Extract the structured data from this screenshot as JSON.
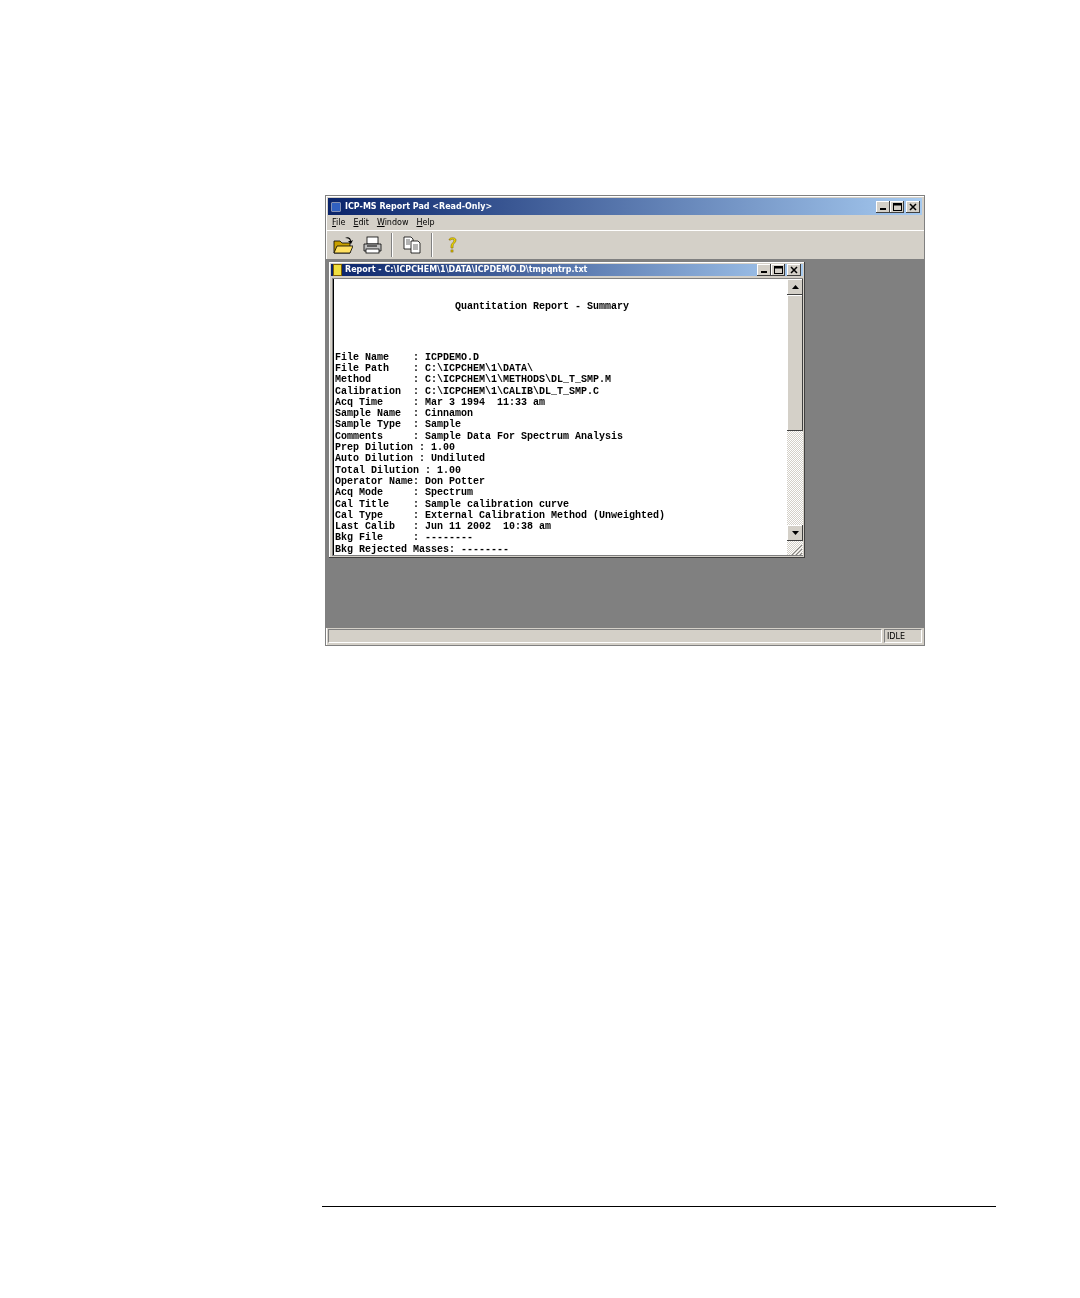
{
  "window": {
    "title": "ICP-MS Report Pad <Read-Only>"
  },
  "menu": [
    "File",
    "Edit",
    "Window",
    "Help"
  ],
  "toolbar": [
    {
      "kind": "open"
    },
    {
      "kind": "print"
    },
    {
      "kind": "separator"
    },
    {
      "kind": "copy"
    },
    {
      "kind": "separator"
    },
    {
      "kind": "help"
    }
  ],
  "report_window": {
    "title": "Report - C:\\ICPCHEM\\1\\DATA\\ICPDEMO.D\\tmpqntrp.txt",
    "heading": "Quantitation Report - Summary",
    "lines": [
      "File Name    : ICPDEMO.D",
      "File Path    : C:\\ICPCHEM\\1\\DATA\\",
      "Method       : C:\\ICPCHEM\\1\\METHODS\\DL_T_SMP.M",
      "Calibration  : C:\\ICPCHEM\\1\\CALIB\\DL_T_SMP.C",
      "Acq Time     : Mar 3 1994  11:33 am",
      "Sample Name  : Cinnamon",
      "Sample Type  : Sample",
      "Comments     : Sample Data For Spectrum Analysis",
      "Prep Dilution : 1.00",
      "Auto Dilution : Undiluted",
      "Total Dilution : 1.00",
      "Operator Name: Don Potter",
      "Acq Mode     : Spectrum",
      "Cal Title    : Sample calibration curve",
      "Cal Type     : External Calibration Method (Unweighted)",
      "Last Calib   : Jun 11 2002  10:38 am",
      "Bkg File     : --------",
      "Bkg Rejected Masses: --------"
    ]
  },
  "status_bar": {
    "state": "IDLE"
  }
}
